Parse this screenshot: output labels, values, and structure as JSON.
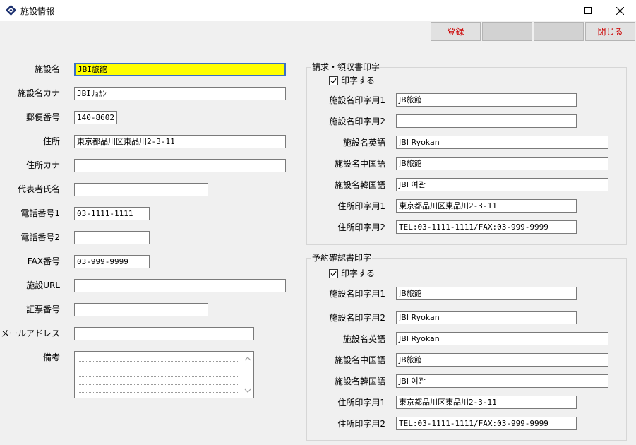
{
  "window": {
    "title": "施設情報",
    "icons": {
      "app": "hotel-app-icon",
      "minimize": "minimize-icon",
      "maximize": "maximize-icon",
      "close": "close-icon"
    }
  },
  "toolbar": {
    "register_label": "登録",
    "blank1_label": "",
    "blank2_label": "",
    "close_label": "閉じる",
    "accent_color": "#cc0000"
  },
  "facility": {
    "name": {
      "label": "施設名",
      "value": "JBI旅館"
    },
    "name_kana": {
      "label": "施設名カナ",
      "value": "JBIﾘｮｶﾝ"
    },
    "postal_code": {
      "label": "郵便番号",
      "value": "140-8602"
    },
    "address": {
      "label": "住所",
      "value": "東京都品川区東品川2-3-11"
    },
    "address_kana": {
      "label": "住所カナ",
      "value": ""
    },
    "representative": {
      "label": "代表者氏名",
      "value": ""
    },
    "phone1": {
      "label": "電話番号1",
      "value": "03-1111-1111"
    },
    "phone2": {
      "label": "電話番号2",
      "value": ""
    },
    "fax": {
      "label": "FAX番号",
      "value": "03-999-9999"
    },
    "url": {
      "label": "施設URL",
      "value": ""
    },
    "certificate": {
      "label": "証票番号",
      "value": ""
    },
    "email": {
      "label": "メールアドレス",
      "value": ""
    },
    "memo": {
      "label": "備考",
      "value": ""
    }
  },
  "invoice_print": {
    "title": "請求・領収書印字",
    "print_label": "印字する",
    "print_checked": true,
    "name_print1": {
      "label": "施設名印字用1",
      "value": "JB旅館"
    },
    "name_print2": {
      "label": "施設名印字用2",
      "value": ""
    },
    "name_en": {
      "label": "施設名英語",
      "value": "JBI Ryokan"
    },
    "name_zh": {
      "label": "施設名中国語",
      "value": "JB旅館"
    },
    "name_ko": {
      "label": "施設名韓国語",
      "value": "JBI 여관"
    },
    "address_print1": {
      "label": "住所印字用1",
      "value": "東京都品川区東品川2-3-11"
    },
    "address_print2": {
      "label": "住所印字用2",
      "value": "TEL:03-1111-1111/FAX:03-999-9999"
    }
  },
  "reservation_print": {
    "title": "予約確認書印字",
    "print_label": "印字する",
    "print_checked": true,
    "name_print1": {
      "label": "施設名印字用1",
      "value": "JB旅館"
    },
    "name_print2": {
      "label": "施設名印字用2",
      "value": "JBI Ryokan"
    },
    "name_en": {
      "label": "施設名英語",
      "value": "JBI Ryokan"
    },
    "name_zh": {
      "label": "施設名中国語",
      "value": "JB旅館"
    },
    "name_ko": {
      "label": "施設名韓国語",
      "value": "JBI 여관"
    },
    "address_print1": {
      "label": "住所印字用1",
      "value": "東京都品川区東品川2-3-11"
    },
    "address_print2": {
      "label": "住所印字用2",
      "value": "TEL:03-1111-1111/FAX:03-999-9999"
    }
  }
}
